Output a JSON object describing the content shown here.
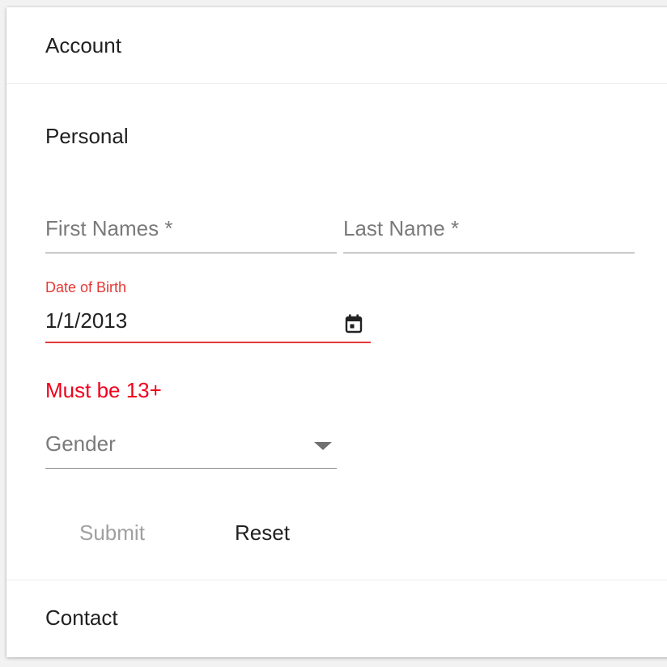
{
  "panels": {
    "account": {
      "label": "Account"
    },
    "personal": {
      "label": "Personal"
    },
    "contact": {
      "label": "Contact"
    }
  },
  "form": {
    "first_name": {
      "placeholder": "First Names *",
      "value": ""
    },
    "last_name": {
      "placeholder": "Last Name *",
      "value": ""
    },
    "dob": {
      "label": "Date of Birth",
      "value": "1/1/2013",
      "icon": "calendar-icon",
      "error": "Must be 13+"
    },
    "gender": {
      "placeholder": "Gender",
      "icon": "chevron-down-icon"
    },
    "submit_label": "Submit",
    "reset_label": "Reset"
  },
  "colors": {
    "error": "#e53935",
    "error_text": "#f0001c",
    "disabled": "#a0a0a0",
    "text": "#212121"
  }
}
